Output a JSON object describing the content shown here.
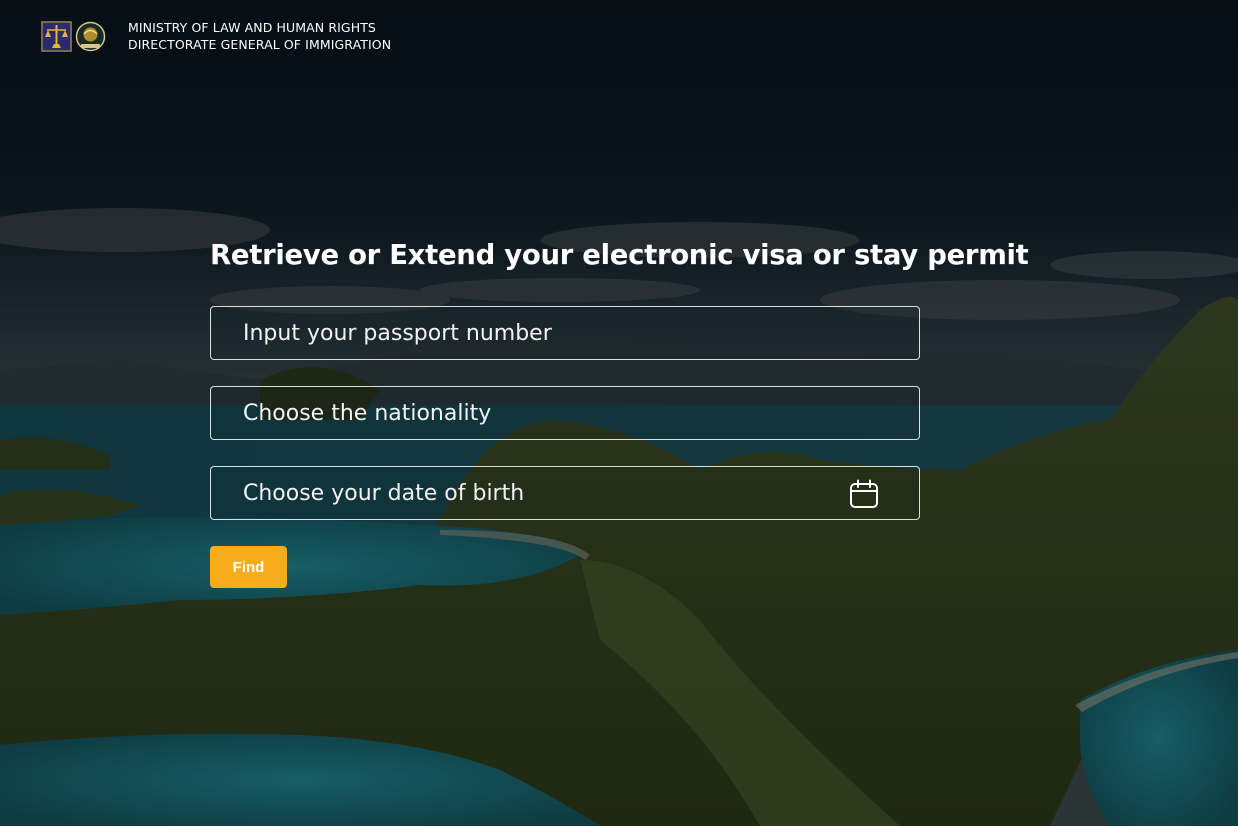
{
  "header": {
    "org_line1": "MINISTRY OF  LAW  AND HUMAN RIGHTS",
    "org_line2": "DIRECTORATE GENERAL OF IMMIGRATION",
    "logo_left_icon": "ministry-emblem-icon",
    "logo_right_icon": "immigration-emblem-icon"
  },
  "main": {
    "title": "Retrieve or Extend your electronic visa or stay permit",
    "passport_placeholder": "Input your passport number",
    "nationality_placeholder": "Choose the nationality",
    "dob_placeholder": "Choose your date of birth",
    "dob_icon": "calendar-icon",
    "find_label": "Find"
  },
  "colors": {
    "accent": "#f5ad1c",
    "text": "#ffffff"
  }
}
